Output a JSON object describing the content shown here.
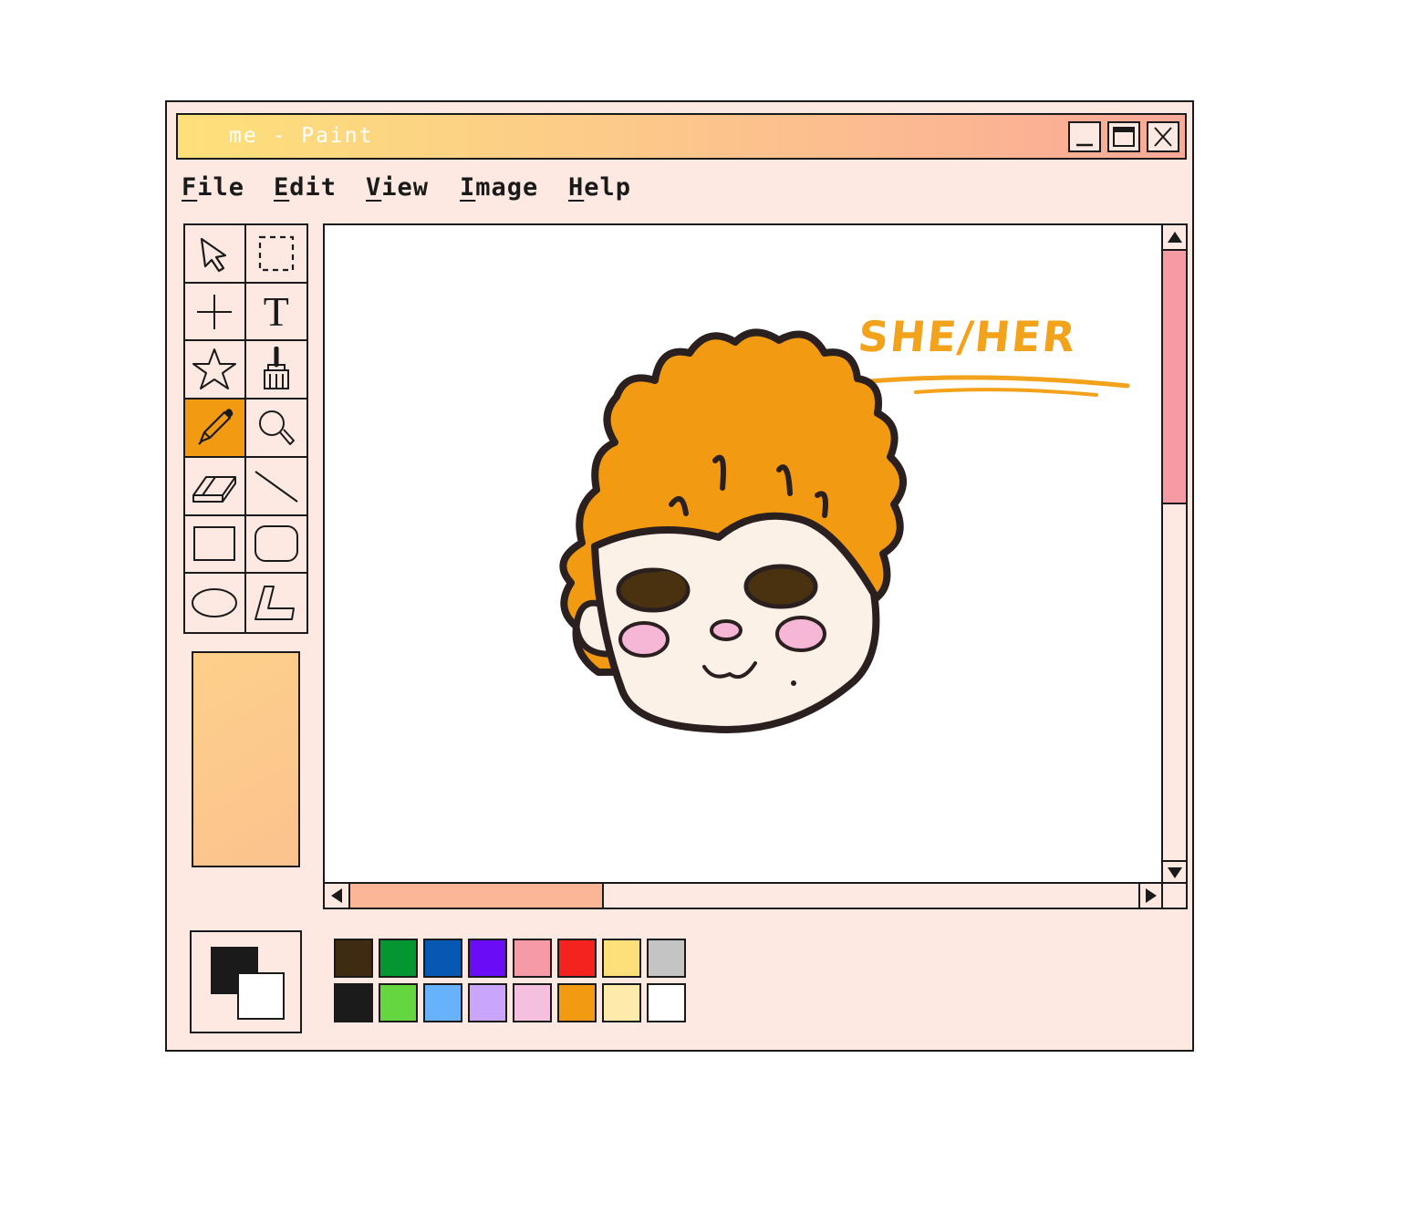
{
  "window": {
    "title": "me - Paint"
  },
  "menu": [
    {
      "first": "F",
      "rest": "ile"
    },
    {
      "first": "E",
      "rest": "dit"
    },
    {
      "first": "V",
      "rest": "iew"
    },
    {
      "first": "I",
      "rest": "mage"
    },
    {
      "first": "H",
      "rest": "elp"
    }
  ],
  "tools": [
    {
      "name": "select-arrow-icon"
    },
    {
      "name": "rect-select-icon"
    },
    {
      "name": "crosshair-icon"
    },
    {
      "name": "text-tool-icon",
      "glyph": "T"
    },
    {
      "name": "star-icon"
    },
    {
      "name": "brush-icon"
    },
    {
      "name": "pencil-icon",
      "active": true
    },
    {
      "name": "magnifier-icon"
    },
    {
      "name": "eraser-icon"
    },
    {
      "name": "line-icon"
    },
    {
      "name": "rectangle-icon"
    },
    {
      "name": "rounded-rectangle-icon"
    },
    {
      "name": "ellipse-icon"
    },
    {
      "name": "polygon-icon"
    }
  ],
  "canvas": {
    "annotation": "SHE/HER",
    "drawing": "curly-orange-hair-portrait"
  },
  "colors": {
    "foreground": "#1a1a1a",
    "background": "#ffffff",
    "palette": [
      "#3f2a12",
      "#049631",
      "#0758b0",
      "#6a0cf5",
      "#f79aa7",
      "#f4231f",
      "#fde07a",
      "#c4c4c4",
      "#1b1b1b",
      "#63d640",
      "#67b2fb",
      "#c9a6fb",
      "#f5c0de",
      "#f29a12",
      "#feebab",
      "#ffffff"
    ]
  }
}
